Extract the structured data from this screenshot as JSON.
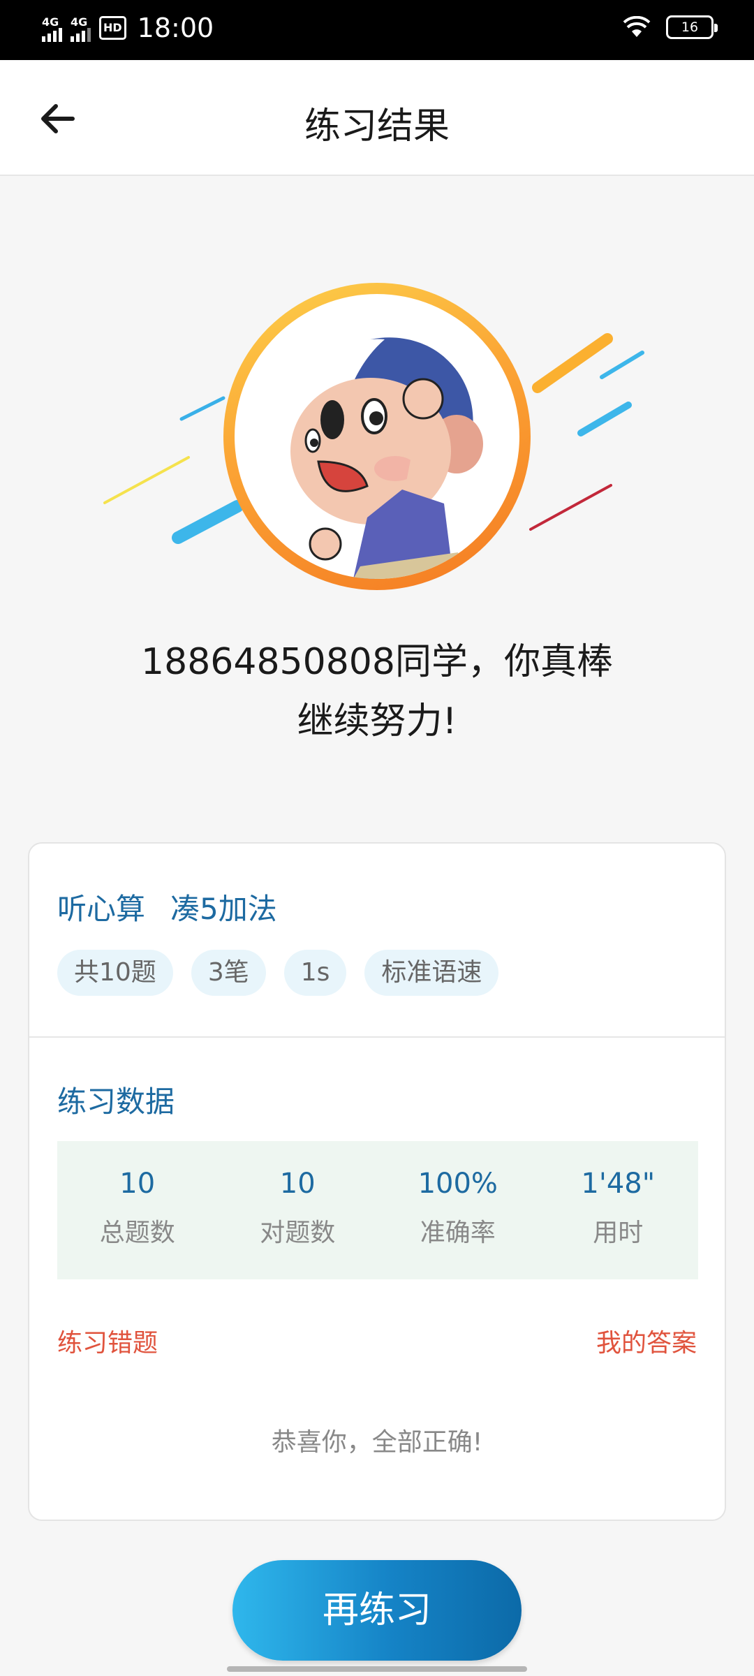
{
  "status_bar": {
    "signal1_label": "4G",
    "signal2_label": "4G",
    "hd_label": "HD",
    "time": "18:00",
    "battery": "16"
  },
  "header": {
    "title": "练习结果",
    "back_icon": "arrow-left-icon"
  },
  "greeting": {
    "line1": "18864850808同学，你真棒",
    "line2": "继续努力!"
  },
  "practice": {
    "type": "听心算",
    "topic": "凑5加法",
    "tags": [
      "共10题",
      "3笔",
      "1s",
      "标准语速"
    ]
  },
  "stats_section": {
    "title": "练习数据",
    "items": [
      {
        "value": "10",
        "label": "总题数"
      },
      {
        "value": "10",
        "label": "对题数"
      },
      {
        "value": "100%",
        "label": "准确率"
      },
      {
        "value": "1'48\"",
        "label": "用时"
      }
    ]
  },
  "wrong": {
    "left": "练习错题",
    "right": "我的答案",
    "empty_text": "恭喜你，全部正确!"
  },
  "retry_button": "再练习",
  "colors": {
    "accent": "#1d6aa1",
    "warn": "#e0533d",
    "button": "#1583c6"
  }
}
